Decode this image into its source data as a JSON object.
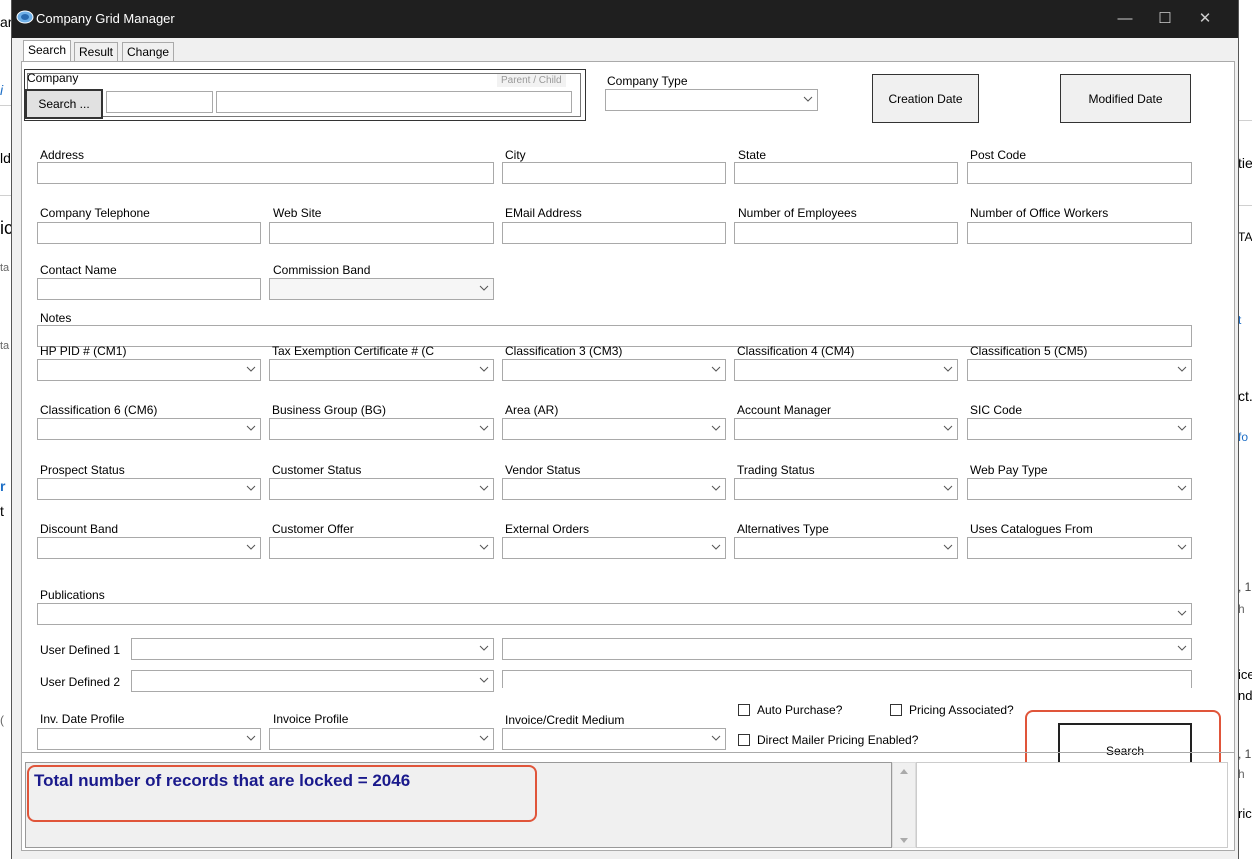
{
  "background": {
    "fragments": [
      "ar",
      "i",
      "ld",
      "tie",
      "ic",
      "TAI",
      "ta",
      "t",
      "ta",
      "ct.c",
      "fo",
      "r",
      "t",
      ", 1",
      "h",
      "ice",
      "ndi",
      "(",
      ", 1(",
      "h",
      "ric"
    ]
  },
  "window": {
    "title": "Company Grid Manager",
    "minimize_glyph": "—",
    "maximize_glyph": "☐",
    "close_glyph": "✕"
  },
  "tabs": [
    {
      "label": "Search"
    },
    {
      "label": "Result"
    },
    {
      "label": "Change"
    }
  ],
  "company": {
    "group_label": "Company",
    "parent_child_label": "Parent / Child",
    "search_button": "Search ..."
  },
  "fields": {
    "company_type": "Company Type",
    "creation_date": "Creation Date",
    "modified_date": "Modified Date",
    "address": "Address",
    "city": "City",
    "state": "State",
    "post_code": "Post Code",
    "company_telephone": "Company Telephone",
    "web_site": "Web Site",
    "email_address": "EMail Address",
    "number_of_employees": "Number of Employees",
    "number_of_office_workers": "Number of Office Workers",
    "contact_name": "Contact Name",
    "commission_band": "Commission Band",
    "notes": "Notes",
    "hp_pid": "HP PID # (CM1)",
    "tax_exemption": "Tax Exemption Certificate # (C",
    "classification3": "Classification 3 (CM3)",
    "classification4": "Classification 4 (CM4)",
    "classification5": "Classification 5 (CM5)",
    "classification6": "Classification 6 (CM6)",
    "business_group": "Business Group (BG)",
    "area": "Area (AR)",
    "account_manager": "Account Manager",
    "sic_code": "SIC Code",
    "prospect_status": "Prospect Status",
    "customer_status": "Customer Status",
    "vendor_status": "Vendor Status",
    "trading_status": "Trading Status",
    "web_pay_type": "Web Pay Type",
    "discount_band": "Discount Band",
    "customer_offer": "Customer Offer",
    "external_orders": "External Orders",
    "alternatives_type": "Alternatives Type",
    "uses_catalogues_from": "Uses Catalogues From",
    "publications": "Publications",
    "user_defined_1": "User Defined 1",
    "user_defined_2": "User Defined 2",
    "inv_date_profile": "Inv. Date Profile",
    "invoice_profile": "Invoice Profile",
    "invoice_credit_medium": "Invoice/Credit Medium",
    "auto_purchase": "Auto Purchase?",
    "pricing_associated": "Pricing Associated?",
    "direct_mailer_pricing": "Direct Mailer Pricing Enabled?"
  },
  "search_button": "Search",
  "status_message": "Total number of records that are locked = 2046",
  "colors": {
    "titlebar": "#1f1f1f",
    "highlight": "#e0553a",
    "status_text": "#1a1a8c",
    "link_blue": "#1e6fc6"
  }
}
